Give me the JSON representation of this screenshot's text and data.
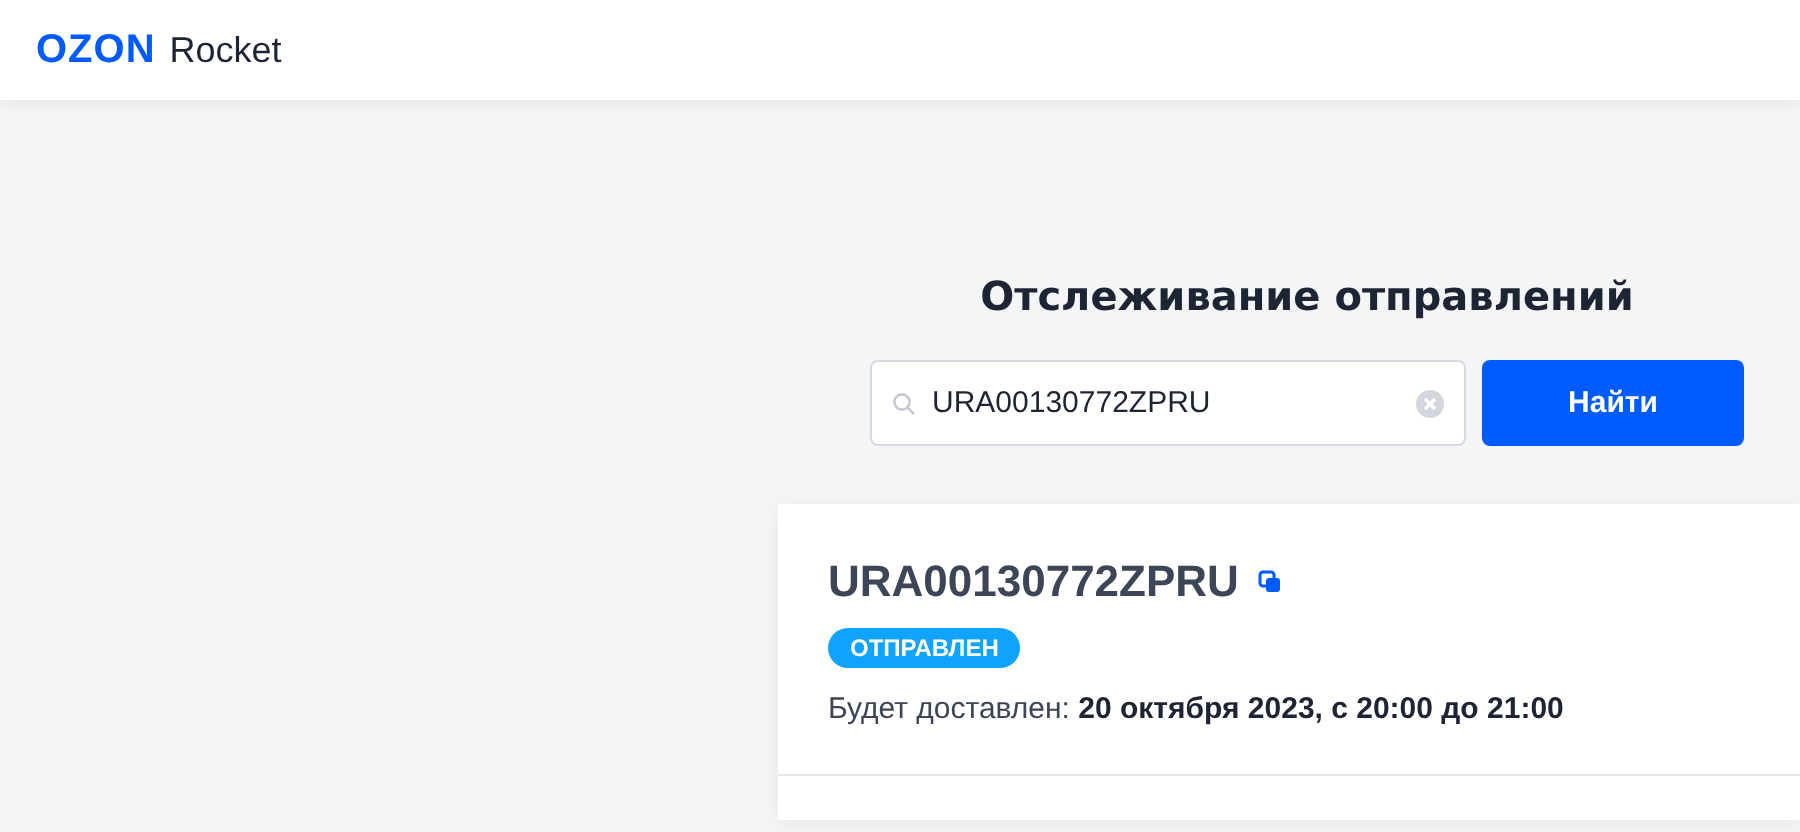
{
  "header": {
    "logo": "OZON",
    "product": "Rocket"
  },
  "tracking": {
    "title": "Отслеживание отправлений",
    "search": {
      "value": "URA00130772ZPRU"
    },
    "button": "Найти"
  },
  "shipment": {
    "number": "URA00130772ZPRU",
    "status": "ОТПРАВЛЕН",
    "delivery": "Будет доставлен: **20 октября 2023, с 20:00 до 21:00**"
  }
}
